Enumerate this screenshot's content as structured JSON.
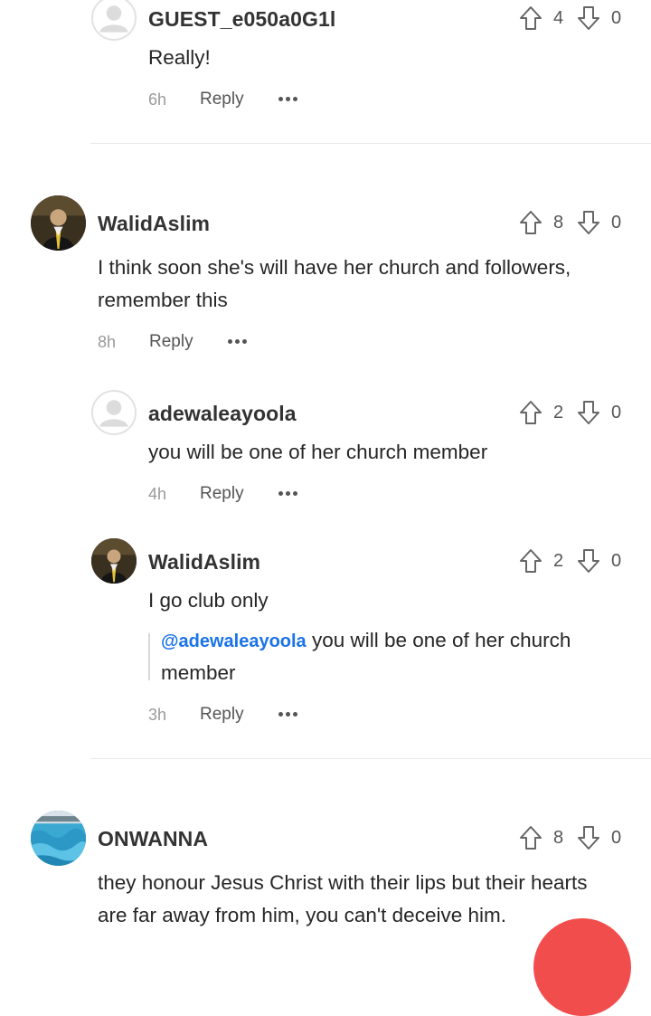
{
  "comments": [
    {
      "user": "GUEST_e050a0G1l",
      "text": "Really!",
      "time": "6h",
      "upvotes": "4",
      "downvotes": "0",
      "reply_label": "Reply",
      "avatar": "guest-avatar-icon"
    },
    {
      "user": "WalidAslim",
      "text": "I think soon she's will have her church and followers, remember this",
      "time": "8h",
      "upvotes": "8",
      "downvotes": "0",
      "reply_label": "Reply",
      "avatar": "user-photo",
      "replies": [
        {
          "user": "adewaleayoola",
          "text": "you will be one of her church member",
          "time": "4h",
          "upvotes": "2",
          "downvotes": "0",
          "reply_label": "Reply",
          "avatar": "guest-avatar-icon"
        },
        {
          "user": "WalidAslim",
          "text": "I go club only",
          "quote_mention": "@adewaleayoola",
          "quote_text_line1": "you will be one of her church",
          "quote_text_line2": "member",
          "time": "3h",
          "upvotes": "2",
          "downvotes": "0",
          "reply_label": "Reply",
          "avatar": "user-photo"
        }
      ]
    },
    {
      "user": "ONWANNA",
      "text_line1": "they honour Jesus Christ with their lips but their hearts",
      "text_line2": "are far away from him, you can't deceive him.",
      "upvotes": "8",
      "downvotes": "0",
      "avatar": "water-photo"
    }
  ],
  "text_lines": {
    "c1_line1": "I think soon she's will have her church and followers,",
    "c1_line2": "remember this"
  },
  "colors": {
    "mention": "#1a73e8",
    "fab": "#f24d4d",
    "divider": "#e8e8e8"
  }
}
